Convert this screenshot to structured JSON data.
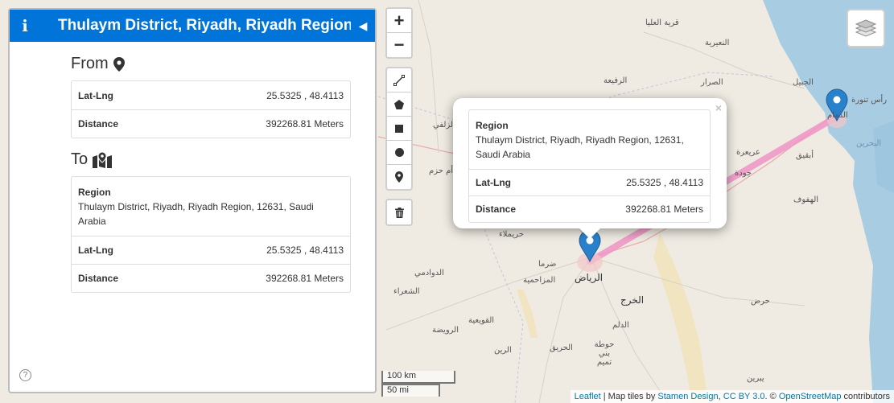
{
  "sidebar": {
    "title": "Thulaym District, Riyadh, Riyadh Region,",
    "info_icon": "info-icon",
    "collapse_icon": "caret-left-icon",
    "from": {
      "title": "From",
      "icon": "map-marker-icon",
      "rows": [
        {
          "key": "Lat-Lng",
          "value": "25.5325 , 48.4113"
        },
        {
          "key": "Distance",
          "value": "392268.81 Meters"
        }
      ]
    },
    "to": {
      "title": "To",
      "icon": "folded-map-marker-icon",
      "region_label": "Region",
      "region_value": "Thulaym District, Riyadh, Riyadh Region, 12631, Saudi Arabia",
      "rows": [
        {
          "key": "Lat-Lng",
          "value": "25.5325 , 48.4113"
        },
        {
          "key": "Distance",
          "value": "392268.81 Meters"
        }
      ]
    },
    "help": "?"
  },
  "zoom": {
    "in": "+",
    "out": "−"
  },
  "draw_tools": [
    "polyline-icon",
    "polygon-icon",
    "rectangle-icon",
    "circle-icon",
    "marker-icon"
  ],
  "trash_icon": "trash-icon",
  "layers_icon": "layers-icon",
  "popup": {
    "close": "×",
    "region_label": "Region",
    "region_value": "Thulaym District, Riyadh, Riyadh Region, 12631, Saudi Arabia",
    "rows": [
      {
        "key": "Lat-Lng",
        "value": "25.5325 , 48.4113"
      },
      {
        "key": "Distance",
        "value": "392268.81 Meters"
      }
    ]
  },
  "scale": {
    "km": "100 km",
    "mi": "50 mi"
  },
  "attribution": {
    "leaflet": "Leaflet",
    "sep1": " | Map tiles by ",
    "stamen": "Stamen Design",
    "sep2": ", ",
    "license": "CC BY 3.0",
    "sep3": ". © ",
    "osm": "OpenStreetMap",
    "tail": " contributors"
  },
  "map_labels": {
    "riyadh": "الرياض",
    "kharj": "الخرج",
    "dammam": "الدمام",
    "hofuf": "الهفوف",
    "bahrain": "البحرين",
    "ras_tanura": "رأس تنورة",
    "qaryat_ulya": "قرية العليا",
    "nairiyah": "النعيرية",
    "rafiyah": "الرفيعة",
    "sarrar": "الصرار",
    "jubail": "الجبيل",
    "uraira": "عريعرة",
    "abqaiq": "أبقيق",
    "judah": "جودة",
    "haradh": "حرض",
    "huraymila": "حريملاء",
    "dawadmi": "الدوادمي",
    "shaqra": "الشعراء",
    "muzahmiyah": "المزاحمية",
    "dirma": "ضرما",
    "quwayiyah": "القويعية",
    "ruwaydah": "الرويضة",
    "dilam": "الدلم",
    "hawtat": "حوطة بني تميم",
    "hariq": "الحريق",
    "rayn": "الرين",
    "yabrin": "يبرين",
    "umm_hazm": "أم حزم",
    "zulfi": "الزلفي"
  }
}
